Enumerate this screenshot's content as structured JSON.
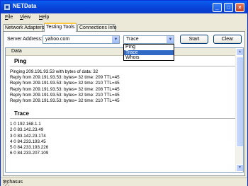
{
  "window": {
    "title": "NETData"
  },
  "menu": [
    "File",
    "View",
    "Help"
  ],
  "tabs": [
    "Network Adapters",
    "Testing Tools",
    "Connections Info"
  ],
  "toolbar": {
    "server_label": "Server Address:",
    "server_value": "yahoo.com",
    "mode_value": "Trace",
    "mode_options": [
      "Ping",
      "Trace",
      "Whois"
    ],
    "start_label": "Start",
    "clear_label": "Clear"
  },
  "results": {
    "column_header": "Data",
    "ping": {
      "title": "Ping",
      "lines": [
        "Pinging 209.191.93.53 with bytes of data: 32",
        "Reply from 209.191.93.53: bytes= 32 time: 209 TTL=45",
        "Reply from 209.191.93.53: bytes= 32 time: 210 TTL=45",
        "Reply from 209.191.93.53: bytes= 32 time: 208 TTL=45",
        "Reply from 209.191.93.53: bytes= 32 time: 210 TTL=45",
        "Reply from 209.191.93.53: bytes= 32 time: 210 TTL=45"
      ]
    },
    "trace": {
      "title": "Trace",
      "lines": [
        "1 0 192.168.1.1",
        "2 0 83.142.23.49",
        "3 0 83.142.23.174",
        "4 0 84.233.193.45",
        "5 0 84.233.193.226",
        "6 0 84.233.207.109"
      ]
    }
  },
  "status": {
    "text": "techasus"
  },
  "colors": {
    "titlebar": "#0a5ef0",
    "selection": "#316ac5",
    "active_tab_accent": "#ffc83c"
  }
}
